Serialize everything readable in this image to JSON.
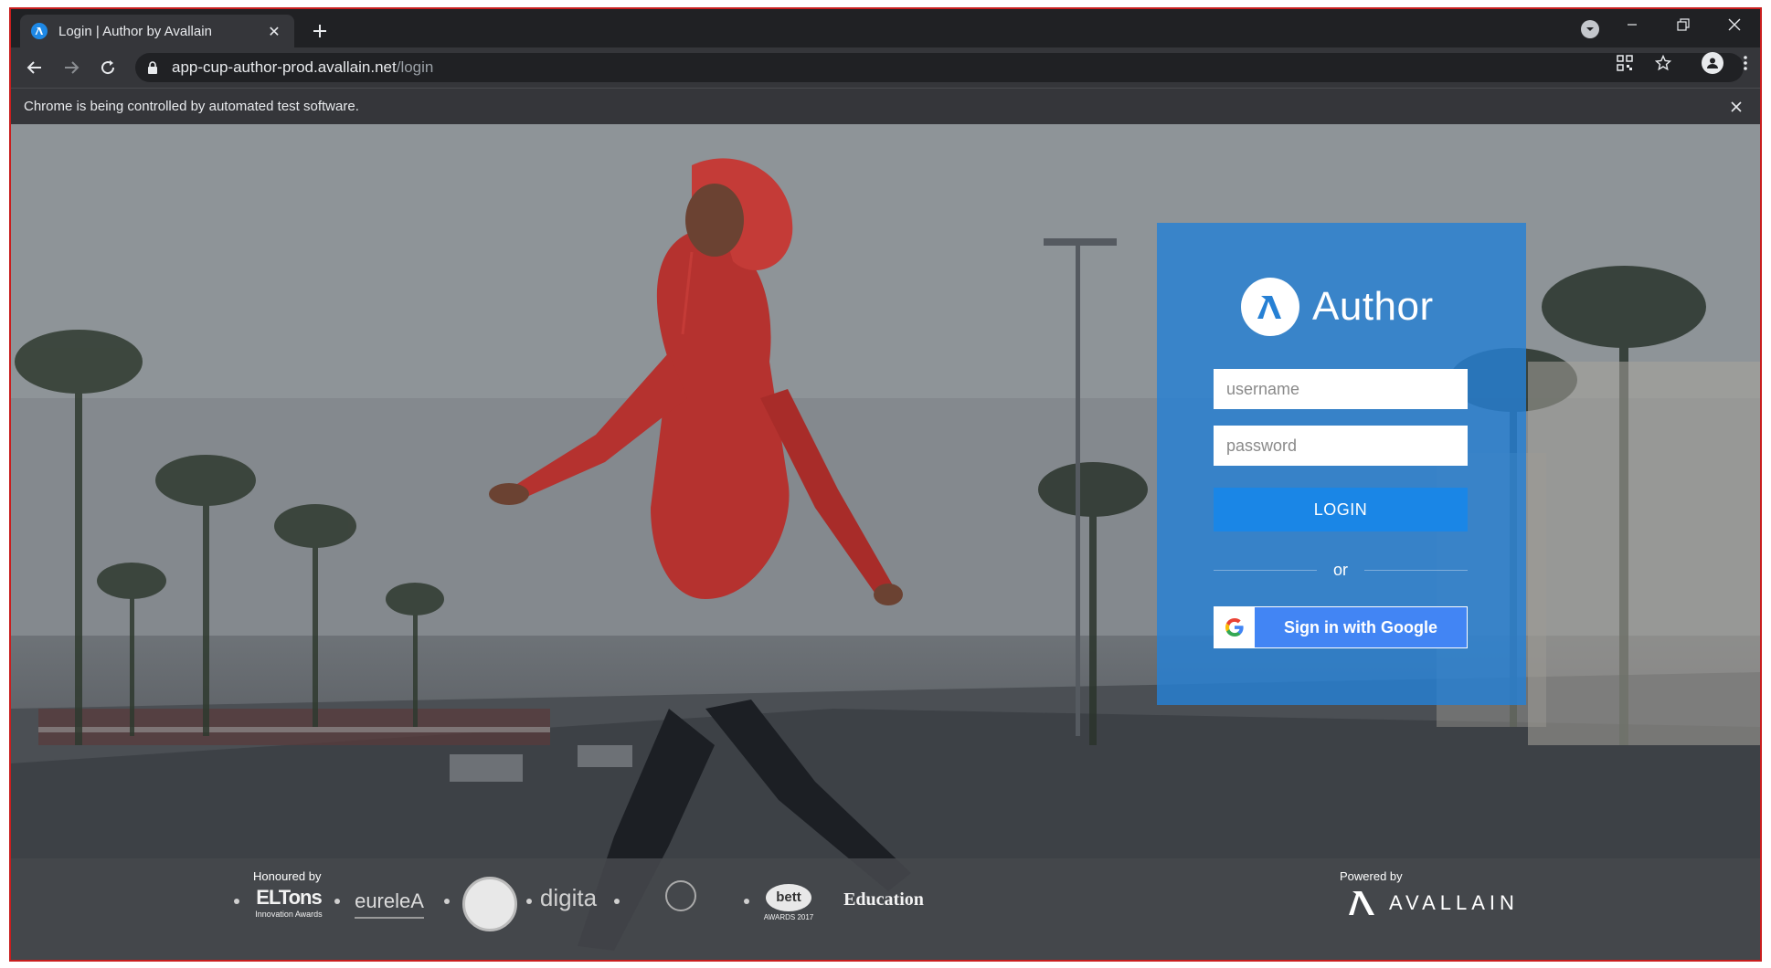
{
  "browser": {
    "tab_title": "Login | Author by Avallain",
    "url_host": "app-cup-author-prod.avallain.net",
    "url_path": "/login",
    "infobar_text": "Chrome is being controlled by automated test software."
  },
  "login": {
    "brand_name": "Author",
    "username_placeholder": "username",
    "password_placeholder": "password",
    "login_label": "LOGIN",
    "or_label": "or",
    "google_label": "Sign in with Google",
    "accent_color": "#1a86e6",
    "card_color": "#2680d4"
  },
  "footer": {
    "honoured_label": "Honoured by",
    "powered_label": "Powered by",
    "powered_brand": "AVALLAIN",
    "awards": [
      {
        "name": "ELTons",
        "sub": "Innovation Awards"
      },
      {
        "name": "eureleA",
        "sub": ""
      },
      {
        "name": "digita",
        "sub": ""
      },
      {
        "name": "bett",
        "sub": "AWARDS 2017"
      },
      {
        "name": "Education",
        "sub": ""
      }
    ]
  }
}
